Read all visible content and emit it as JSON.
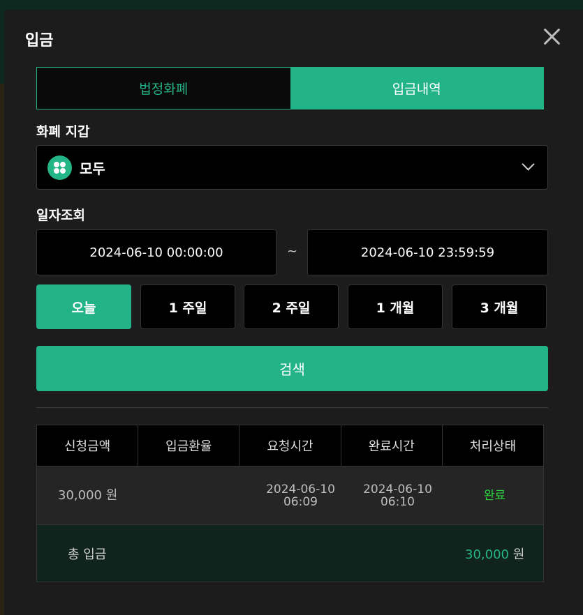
{
  "modal": {
    "title": "입금"
  },
  "tabs": [
    {
      "label": "법정화폐",
      "active": false
    },
    {
      "label": "입금내역",
      "active": true
    }
  ],
  "wallet": {
    "label": "화폐 지갑",
    "selected": "모두"
  },
  "date": {
    "label": "일자조회",
    "from": "2024-06-10 00:00:00",
    "separator": "~",
    "to": "2024-06-10 23:59:59"
  },
  "periods": [
    {
      "label": "오늘",
      "active": true
    },
    {
      "label": "1 주일",
      "active": false
    },
    {
      "label": "2 주일",
      "active": false
    },
    {
      "label": "1 개월",
      "active": false
    },
    {
      "label": "3 개월",
      "active": false
    }
  ],
  "search_label": "검색",
  "table": {
    "headers": [
      "신청금액",
      "입금환율",
      "요청시간",
      "완료시간",
      "처리상태"
    ],
    "rows": [
      {
        "amount": "30,000 원",
        "rate": "",
        "request_date": "2024-06-10",
        "request_time": "06:09",
        "complete_date": "2024-06-10",
        "complete_time": "06:10",
        "status": "완료"
      }
    ],
    "total_label": "총 입금",
    "total_value": "30,000",
    "total_unit": "원"
  },
  "colors": {
    "accent": "#22b486",
    "status_done": "#2bd63f"
  }
}
